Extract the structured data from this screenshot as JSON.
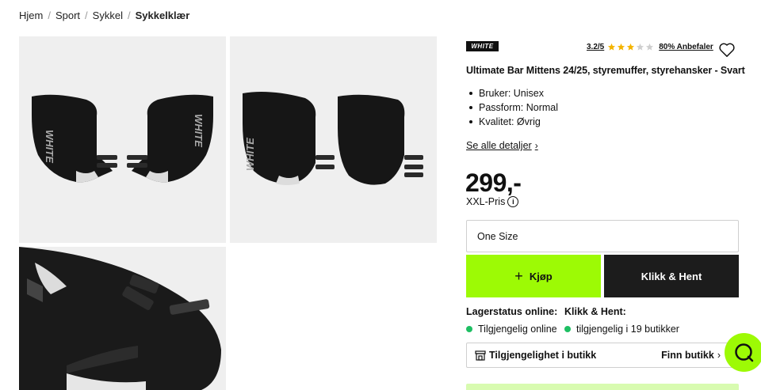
{
  "breadcrumb": {
    "items": [
      "Hjem",
      "Sport",
      "Sykkel"
    ],
    "current": "Sykkelklær"
  },
  "gallery": {
    "images": [
      {
        "subject": "mittens-front-pair",
        "brand_print": "WHITE"
      },
      {
        "subject": "mittens-back-pair",
        "brand_print": "WHITE"
      },
      {
        "subject": "mitten-closeup"
      }
    ]
  },
  "product": {
    "brand_logo_text": "WHITE",
    "rating_text": "3.2/5",
    "rating_value": 3.2,
    "rating_max": 5,
    "recommend_text": "80% Anbefaler",
    "title": "Ultimate Bar Mittens 24/25, styremuffer, styrehansker - Svart",
    "specs": [
      "Bruker: Unisex",
      "Passform: Normal",
      "Kvalitet: Øvrig"
    ],
    "see_all_label": "Se alle detaljer",
    "price": "299,-",
    "price_label": "XXL-Pris",
    "size_value": "One Size",
    "buy_label": "Kjøp",
    "clickhent_label": "Klikk & Hent"
  },
  "stock": {
    "online_heading": "Lagerstatus online:",
    "online_status": "Tilgjengelig online",
    "store_heading": "Klikk & Hent:",
    "store_status": "tilgjengelig i 19 butikker"
  },
  "store_availability": {
    "label": "Tilgjengelighet i butikk",
    "link": "Finn butikk"
  },
  "colors": {
    "accent": "#9dfa05",
    "dark_button": "#1c1c1c",
    "star_filled": "#f4b400",
    "star_empty": "#cfcfcf",
    "in_stock": "#1ebf63"
  },
  "icons": {
    "heart": "wishlist-heart-icon",
    "info": "info-icon",
    "plus": "plus-icon",
    "store": "store-icon",
    "chat": "chat-bubble-icon",
    "chevron": "chevron-right-icon"
  }
}
